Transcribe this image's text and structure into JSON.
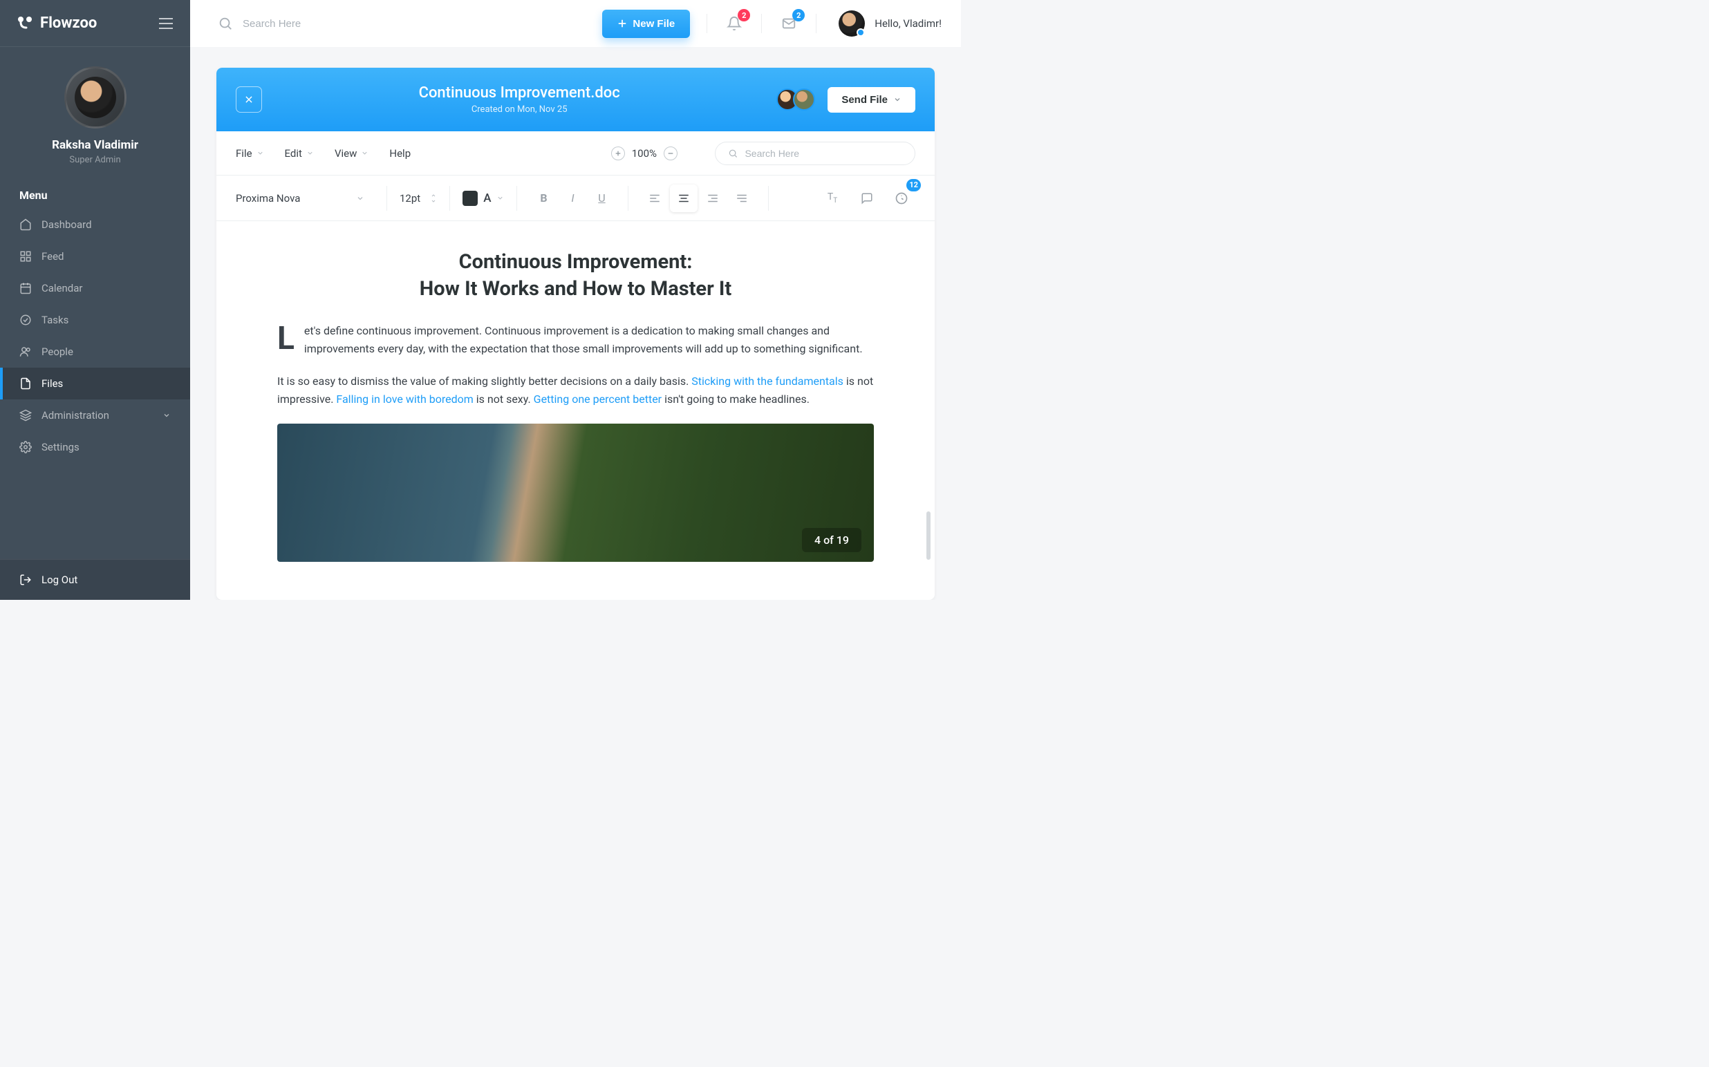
{
  "brand": "Flowzoo",
  "profile": {
    "name": "Raksha Vladimir",
    "role": "Super Admin"
  },
  "menu_heading": "Menu",
  "nav": [
    {
      "icon": "home",
      "label": "Dashboard",
      "active": false
    },
    {
      "icon": "grid",
      "label": "Feed",
      "active": false
    },
    {
      "icon": "calendar",
      "label": "Calendar",
      "active": false
    },
    {
      "icon": "check",
      "label": "Tasks",
      "active": false
    },
    {
      "icon": "people",
      "label": "People",
      "active": false
    },
    {
      "icon": "file",
      "label": "Files",
      "active": true
    },
    {
      "icon": "layers",
      "label": "Administration",
      "active": false,
      "expandable": true
    },
    {
      "icon": "gear",
      "label": "Settings",
      "active": false
    }
  ],
  "logout": "Log Out",
  "topbar": {
    "search_placeholder": "Search Here",
    "new_file": "New File",
    "notifications_count": "2",
    "messages_count": "2",
    "greeting": "Hello, Vladimr!"
  },
  "doc": {
    "title": "Continuous Improvement.doc",
    "subtitle": "Created on Mon, Nov 25",
    "send_label": "Send File"
  },
  "menubar": {
    "file": "File",
    "edit": "Edit",
    "view": "View",
    "help": "Help",
    "zoom": "100%",
    "search_placeholder": "Search Here"
  },
  "format": {
    "font": "Proxima Nova",
    "size": "12pt",
    "color_btn": "A",
    "history_count": "12"
  },
  "content": {
    "heading_line1": "Continuous Improvement:",
    "heading_line2": "How It Works and How to Master It",
    "dropcap": "L",
    "p1": "et's define continuous improvement. Continuous improvement is a dedication to making small changes and improvements every day, with the expectation that those small improvements will add up to something significant.",
    "p2a": "It is so easy to dismiss the value of making slightly better decisions on a daily basis. ",
    "link1": "Sticking with the fundamentals",
    "p2b": " is not impressive. ",
    "link2": "Falling in love with boredom",
    "p2c": " is not sexy. ",
    "link3": "Getting one percent better",
    "p2d": " isn't going to make headlines.",
    "img_counter": "4 of 19"
  }
}
